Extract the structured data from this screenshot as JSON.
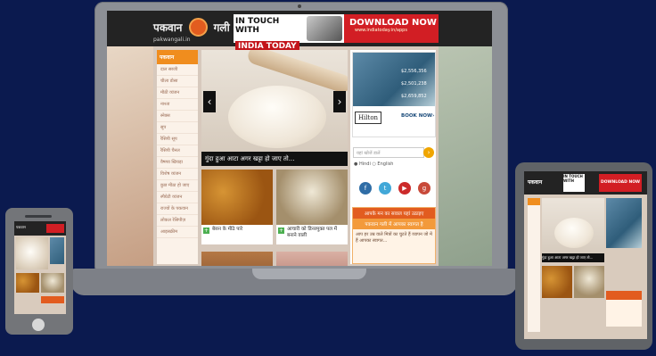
{
  "site": {
    "logo_main": "पकवान",
    "logo_second": "गली",
    "logo_domain": "pakwangali.in"
  },
  "ad": {
    "line1": "IN TOUCH WITH",
    "line2": "INDIA TODAY",
    "download": "DOWNLOAD NOW",
    "url": "www.indiatoday.in/apps"
  },
  "sidebar": {
    "title": "पकवान",
    "items": [
      "दाल सब्जी",
      "चीला डोसा",
      "मीठी व्यंजन",
      "नाश्ता",
      "स्नेक्स",
      "सूप",
      "रैसिपी सूप",
      "रैसिपी चैनल",
      "वैष्णव खिचड़ा",
      "विशेष व्यंजन",
      "कुछ मीठा हो जाए",
      "स्पैघेटी व्यंजन",
      "राज्यों के पकवान",
      "लोकल रेसिपीज़",
      "आइसक्रीम"
    ]
  },
  "slider": {
    "caption": "गुंदा हुआ आटा अगर खट्टा हो जाए तो...",
    "prev": "‹",
    "next": "›"
  },
  "thumbs": [
    {
      "caption": "बेसन के मीठे पारे"
    },
    {
      "caption": "आचारी को डिनरमुक्त पल में बनाने वाली"
    },
    {
      "caption": ""
    },
    {
      "caption": ""
    }
  ],
  "hilton_ad": {
    "brand": "Hilton",
    "cta": "BOOK NOW›",
    "price1": "$2,556,356",
    "price2": "$2,501,238",
    "price3": "$2,659,852"
  },
  "search": {
    "placeholder": "यहां खोजें डालें",
    "lang1": "Hindi",
    "lang2": "English",
    "button": "›"
  },
  "social": [
    {
      "icon": "facebook-icon",
      "glyph": "f",
      "color": "#2f6da6"
    },
    {
      "icon": "twitter-icon",
      "glyph": "t",
      "color": "#42a8d8"
    },
    {
      "icon": "youtube-icon",
      "glyph": "▶",
      "color": "#cc2a2a"
    },
    {
      "icon": "google-plus-icon",
      "glyph": "g",
      "color": "#c84a3a"
    }
  ],
  "promo": {
    "title": "आपके मन का सवाल यहां उठाइए",
    "subtitle": "पकवान गली में आपका स्वागत है",
    "text": "आप हर उम्र वाले मित्रों का चुटते हैं व्यापन जो में हैं आपका स्वागत..."
  },
  "colors": {
    "page_bg": "#0b1a4f",
    "accent": "#f08d1e",
    "header": "#232323",
    "ad_red": "#d21e24"
  }
}
